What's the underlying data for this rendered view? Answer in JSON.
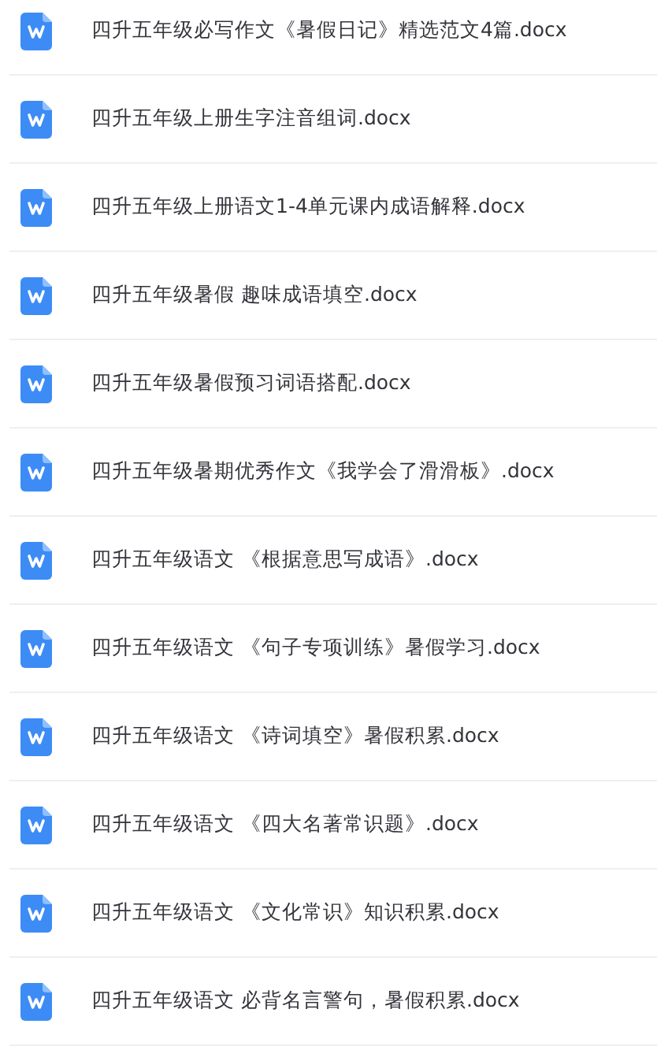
{
  "files": [
    {
      "name": "四升五年级必写作文《暑假日记》精选范文4篇.docx"
    },
    {
      "name": "四升五年级上册生字注音组词.docx"
    },
    {
      "name": "四升五年级上册语文1-4单元课内成语解释.docx"
    },
    {
      "name": "四升五年级暑假 趣味成语填空.docx"
    },
    {
      "name": "四升五年级暑假预习词语搭配.docx"
    },
    {
      "name": "四升五年级暑期优秀作文《我学会了滑滑板》.docx"
    },
    {
      "name": "四升五年级语文 《根据意思写成语》.docx"
    },
    {
      "name": "四升五年级语文 《句子专项训练》暑假学习.docx"
    },
    {
      "name": "四升五年级语文 《诗词填空》暑假积累.docx"
    },
    {
      "name": "四升五年级语文 《四大名著常识题》.docx"
    },
    {
      "name": "四升五年级语文 《文化常识》知识积累.docx"
    },
    {
      "name": "四升五年级语文 必背名言警句，暑假积累.docx"
    }
  ]
}
